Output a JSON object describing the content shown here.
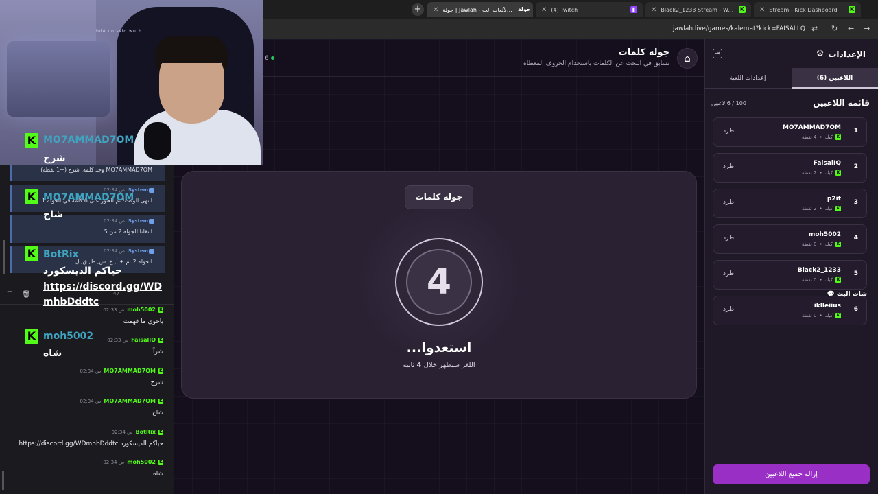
{
  "browser": {
    "tabs": [
      {
        "label": "جولة | Jawlah - منصة الألعاب الت...",
        "icon": "jawlah-logo-icon"
      },
      {
        "label": "(4) Twitch",
        "icon": "twitch-icon"
      },
      {
        "label": "Black2_1233 Stream - Watch Li...",
        "icon": "kick-icon"
      },
      {
        "label": "Stream - Kick Dashboard",
        "icon": "kick-icon"
      }
    ],
    "new_tab": "+",
    "close": "✕",
    "url": "jawlah.live/games/kalemat?kick=FAISALLQ"
  },
  "game": {
    "title": "جوله كلمات",
    "subtitle": "تسابق في البحث عن الكلمات باستخدام الحروف المعطاة",
    "online_count": "6",
    "round_label": "جوله كلمات",
    "countdown": "4",
    "ready_title": "استعدوا...",
    "ready_sub_pre": "اللغز سيظهر خلال",
    "ready_sub_num": "4",
    "ready_sub_post": "ثانية"
  },
  "settings": {
    "title": "الإعدادات",
    "tabs": [
      {
        "label": "اللاعبين (6)",
        "active": true
      },
      {
        "label": "إعدادات اللعبة",
        "active": false
      }
    ],
    "players_heading": "قائمة اللاعبين",
    "players_count": "100 / 6 لاعبين",
    "kick_label": "طرد",
    "players": [
      {
        "rank": "1",
        "name": "MO7AMMAD7OM",
        "platform": "كيك",
        "points": "4 نقطة"
      },
      {
        "rank": "2",
        "name": "FaisalIQ",
        "platform": "كيك",
        "points": "2 نقطة"
      },
      {
        "rank": "3",
        "name": "p2it",
        "platform": "كيك",
        "points": "2 نقطة"
      },
      {
        "rank": "4",
        "name": "moh5002",
        "platform": "كيك",
        "points": "0 نقطة"
      },
      {
        "rank": "5",
        "name": "Black2_1233",
        "platform": "كيك",
        "points": "0 نقطة"
      },
      {
        "rank": "6",
        "name": "iklleiius",
        "platform": "كيك",
        "points": "0 نقطة"
      }
    ],
    "remove_all": "إزالة جميع اللاعبين"
  },
  "overlay": {
    "cam_text": "bd4 noisslq.wuth",
    "alerts": [
      {
        "name": "MO7AMMAD7OM",
        "message": "شرح"
      },
      {
        "name": "MO7AMMAD7OM",
        "message": "شاح"
      },
      {
        "name": "BotRix",
        "message": "حياكم الديسكورد",
        "link1": "https://discord.gg/WD",
        "link2": "mhbDddtc"
      },
      {
        "name": "moh5002",
        "message": "شاه"
      }
    ]
  },
  "system_chat": [
    {
      "name": "",
      "time": "",
      "text": "MO7AMMAD7OM وجد كلمة: شرح (+1 نقطة)"
    },
    {
      "name": "System",
      "time": "02:34 ص",
      "text": "انتهى الوقت! تم العثور على 6 كلمة في الجولة 1"
    },
    {
      "name": "System",
      "time": "02:34 ص",
      "text": "انتقلنا للجوله 2 من 5"
    },
    {
      "name": "System",
      "time": "02:34 ص",
      "text": "الجوله 2: م + أ, خ, س, ظ, ق, ل"
    }
  ],
  "chat": {
    "title": "شات البث",
    "badge": "47",
    "messages": [
      {
        "name": "moh5002",
        "time": "02:33 ص",
        "text": "ياخوي ما فهمت"
      },
      {
        "name": "FaisalIQ",
        "time": "02:33 ص",
        "text": "شرآ"
      },
      {
        "name": "MO7AMMAD7OM",
        "time": "02:34 ص",
        "text": "شرح"
      },
      {
        "name": "MO7AMMAD7OM",
        "time": "02:34 ص",
        "text": "شاح"
      },
      {
        "name": "BotRix",
        "time": "02:34 ص",
        "text": "حياكم الديسكورد https://discord.gg/WDmhbDddtc"
      },
      {
        "name": "moh5002",
        "time": "02:34 ص",
        "text": "شاه"
      }
    ]
  },
  "colors": {
    "kick_green": "#53fc18",
    "accent_purple": "#9a2fc6",
    "bg": "#140e1d"
  }
}
